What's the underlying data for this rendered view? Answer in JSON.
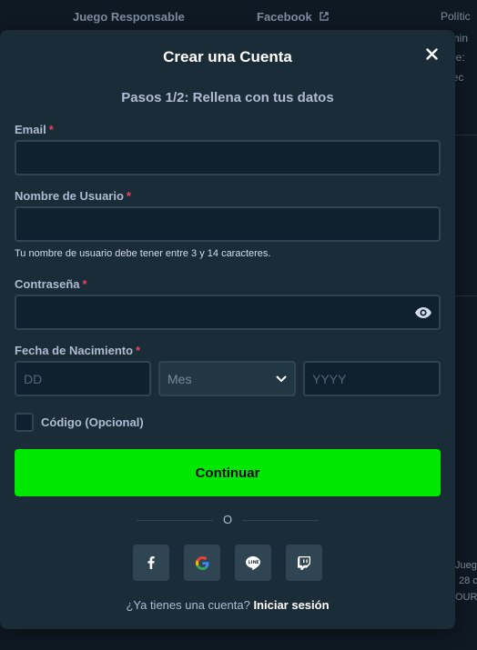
{
  "background": {
    "links_left": [
      "Juego Responsable"
    ],
    "links_mid": [
      "Facebook"
    ],
    "right_col": [
      "Polític",
      "ermin",
      "ntoe:",
      "imec",
      "Jueg",
      "28 c",
      "OURT"
    ]
  },
  "modal": {
    "title": "Crear una Cuenta",
    "step": "Pasos 1/2: Rellena con tus datos",
    "email_label": "Email",
    "username_label": "Nombre de Usuario",
    "username_hint": "Tu nombre de usuario debe tener entre 3 y 14 caracteres.",
    "password_label": "Contraseña",
    "dob_label": "Fecha de Nacimiento",
    "required_mark": "*",
    "dob": {
      "day_placeholder": "DD",
      "month_selected": "Mes",
      "year_placeholder": "YYYY"
    },
    "code_label": "Código (Opcional)",
    "continue_label": "Continuar",
    "or_text": "O",
    "social_icons": [
      "facebook-icon",
      "google-icon",
      "line-icon",
      "twitch-icon"
    ],
    "footer_question": "¿Ya tienes una cuenta?",
    "footer_link": "Iniciar sesión"
  },
  "colors": {
    "accent_green": "#00e701",
    "modal_bg": "#1a2c38",
    "input_bg": "#0f212e",
    "required_red": "#ed4163"
  }
}
